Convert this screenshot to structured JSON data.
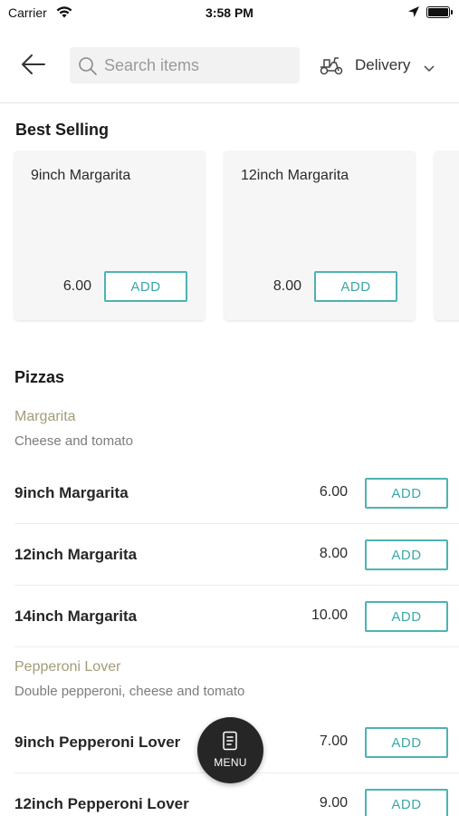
{
  "status_bar": {
    "carrier": "Carrier",
    "time": "3:58 PM"
  },
  "header": {
    "search_placeholder": "Search items",
    "delivery_label": "Delivery"
  },
  "best_selling": {
    "title": "Best Selling",
    "items": [
      {
        "name": "9inch Margarita",
        "price": "6.00",
        "add_label": "ADD"
      },
      {
        "name": "12inch Margarita",
        "price": "8.00",
        "add_label": "ADD"
      }
    ]
  },
  "pizzas": {
    "title": "Pizzas",
    "groups": [
      {
        "name": "Margarita",
        "description": "Cheese and tomato",
        "items": [
          {
            "name": "9inch Margarita",
            "price": "6.00",
            "add_label": "ADD"
          },
          {
            "name": "12inch Margarita",
            "price": "8.00",
            "add_label": "ADD"
          },
          {
            "name": "14inch Margarita",
            "price": "10.00",
            "add_label": "ADD"
          }
        ]
      },
      {
        "name": "Pepperoni Lover",
        "description": "Double pepperoni, cheese and tomato",
        "items": [
          {
            "name": "9inch Pepperoni Lover",
            "price": "7.00",
            "add_label": "ADD"
          },
          {
            "name": "12inch Pepperoni Lover",
            "price": "9.00",
            "add_label": "ADD"
          }
        ]
      }
    ]
  },
  "menu_button": {
    "label": "MENU"
  },
  "colors": {
    "accent": "#4db3b3",
    "group_name": "#a39c78",
    "fab": "#262626"
  },
  "icons": [
    "wifi-icon",
    "location-arrow-icon",
    "battery-icon",
    "back-arrow-icon",
    "search-icon",
    "scooter-icon",
    "chevron-down-icon",
    "menu-icon"
  ]
}
